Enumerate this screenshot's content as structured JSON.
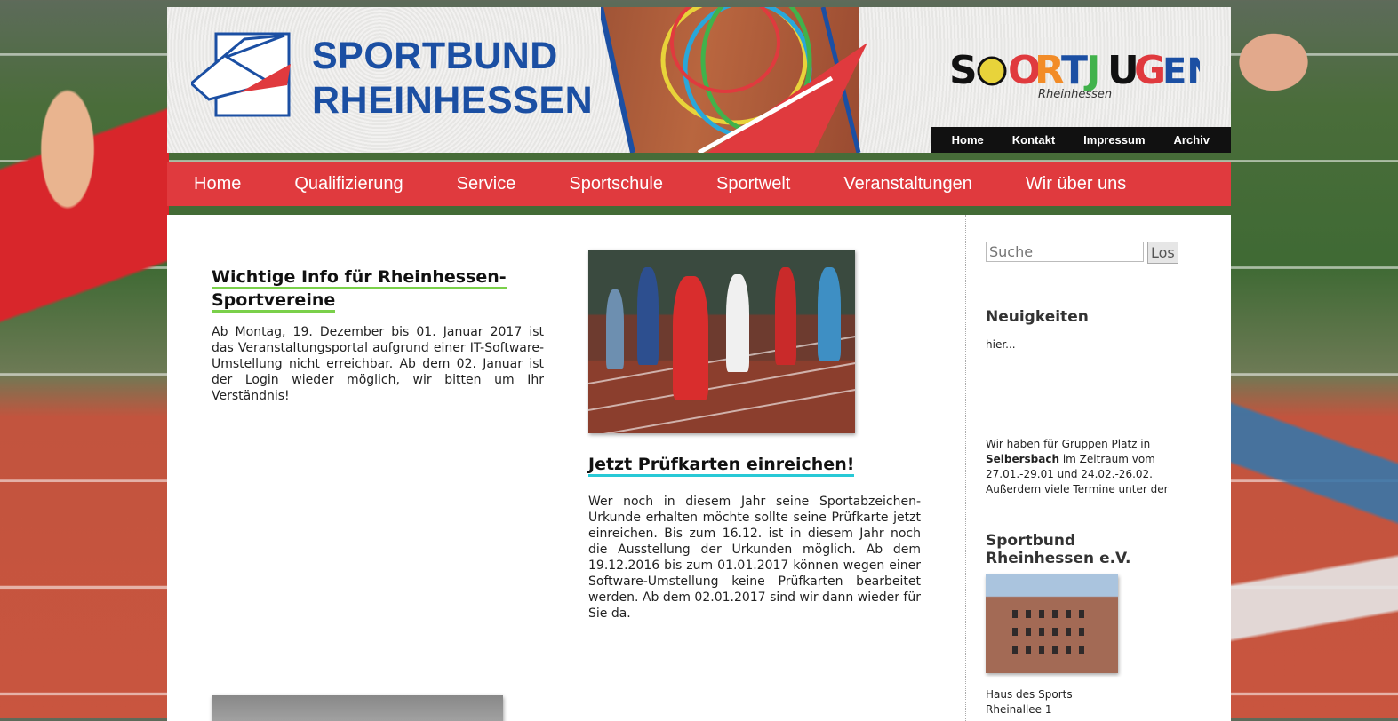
{
  "header": {
    "logo_line1": "SPORTBUND",
    "logo_line2": "RHEINHESSEN",
    "sportjugend_logo": "SPORTJUGEND",
    "sportjugend_sub": "Rheinhessen",
    "top_nav": [
      "Home",
      "Kontakt",
      "Impressum",
      "Archiv"
    ]
  },
  "main_nav": [
    "Home",
    "Qualifizierung",
    "Service",
    "Sportschule",
    "Sportwelt",
    "Veranstaltungen",
    "Wir über uns"
  ],
  "posts": [
    {
      "title_line1": "Wichtige Info für Rheinhessen-",
      "title_line2": "Sportvereine",
      "text": "Ab Montag, 19. Dezember bis 01. Januar 2017 ist das Veranstaltungsportal aufgrund einer IT-Software-Umstellung nicht erreichbar. Ab dem 02. Januar ist der Login wieder möglich, wir bitten um Ihr Verständnis!"
    },
    {
      "title": "Jetzt Prüfkarten einreichen!",
      "text": "Wer noch in diesem Jahr seine Sportabzeichen-Urkunde erhalten möchte sollte seine Prüfkarte jetzt einreichen. Bis zum 16.12. ist in diesem Jahr noch die Ausstellung der Urkunden möglich. Ab dem 19.12.2016 bis zum 01.01.2017 können wegen einer Software-Umstellung keine Prüfkarten bearbeitet werden. Ab dem 02.01.2017 sind wir dann wieder für Sie da."
    }
  ],
  "sidebar": {
    "search_placeholder": "Suche",
    "search_button": "Los",
    "news_heading": "Neuigkeiten",
    "news_text": "hier...",
    "promo_prefix": "Wir haben für Gruppen Platz in ",
    "promo_bold": "Seibersbach",
    "promo_suffix": " im Zeitraum vom 27.01.-29.01 und 24.02.-26.02. Außerdem viele Termine unter der",
    "org_heading_line1": "Sportbund",
    "org_heading_line2": "Rheinhessen e.V.",
    "address_line1": "Haus des Sports",
    "address_line2": "Rheinallee 1"
  },
  "colors": {
    "nav_red": "#e03a3e",
    "logo_blue": "#1b4fa3",
    "underline_green": "#7ad04a",
    "underline_cyan": "#28c9d6"
  }
}
